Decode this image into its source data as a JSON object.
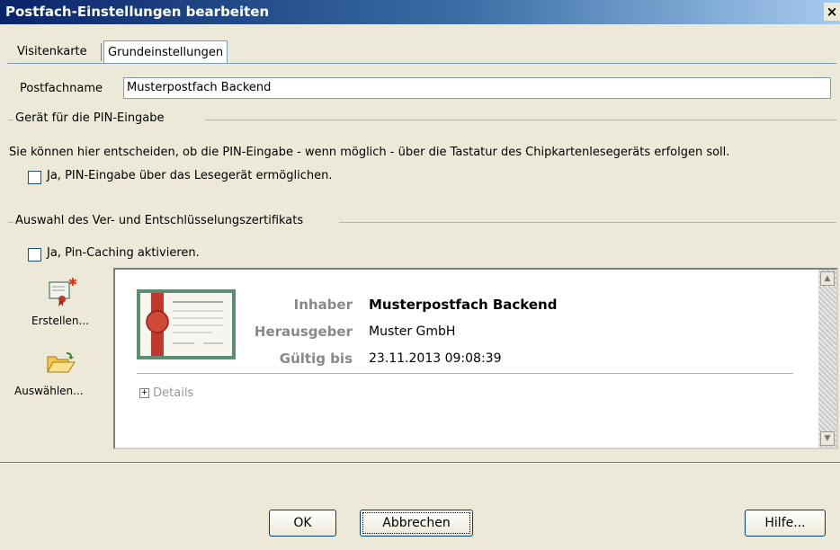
{
  "window": {
    "title": "Postfach-Einstellungen bearbeiten",
    "close": "×"
  },
  "tabs": [
    {
      "label": "Visitenkarte",
      "active": false
    },
    {
      "label": "Grundeinstellungen",
      "active": true
    }
  ],
  "mailbox": {
    "label": "Postfachname",
    "value": "Musterpostfach Backend"
  },
  "pin_group": {
    "title": "Gerät für die PIN-Eingabe",
    "description": "Sie können hier entscheiden, ob die PIN-Eingabe - wenn möglich - über die Tastatur des Chipkartenlesegeräts erfolgen soll.",
    "checkbox_label": "Ja, PIN-Eingabe über das Lesegerät ermöglichen.",
    "checked": false
  },
  "cert_group": {
    "title": "Auswahl des Ver- und Entschlüsselungszertifikats",
    "pin_cache_label": "Ja, Pin-Caching aktivieren.",
    "pin_cache_checked": false,
    "actions": [
      {
        "label": "Erstellen...",
        "icon": "create-certificate-icon"
      },
      {
        "label": "Auswählen...",
        "icon": "open-folder-icon"
      }
    ],
    "certificate": {
      "owner_label": "Inhaber",
      "owner": "Musterpostfach Backend",
      "issuer_label": "Herausgeber",
      "issuer": "Muster GmbH",
      "valid_label": "Gültig bis",
      "valid_until": "23.11.2013 09:08:39",
      "details_label": "Details",
      "expander": "+"
    }
  },
  "buttons": {
    "ok": "OK",
    "cancel": "Abbrechen",
    "help": "Hilfe..."
  },
  "colors": {
    "titlebar_start": "#0a246a",
    "titlebar_end": "#a6caf0",
    "dialog_bg": "#ece9d8"
  }
}
